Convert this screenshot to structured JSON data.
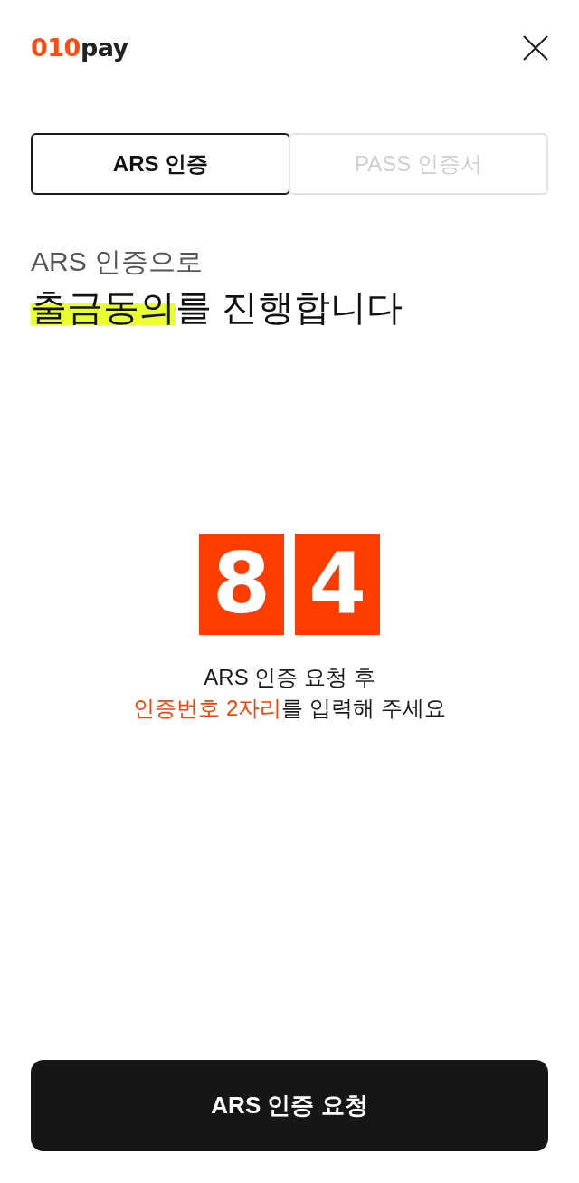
{
  "header": {
    "logo": {
      "accent": "010",
      "rest": "pay"
    }
  },
  "tabs": [
    {
      "label": "ARS 인증",
      "selected": true
    },
    {
      "label": "PASS 인증서",
      "selected": false
    }
  ],
  "heading": {
    "subtitle": "ARS 인증으로",
    "title": [
      {
        "text": "출금동의",
        "highlighted": true
      },
      {
        "text": "를 진행합니다",
        "highlighted": false
      }
    ]
  },
  "code": {
    "digits": [
      "8",
      "4"
    ]
  },
  "instruction": {
    "lines": [
      [
        {
          "text": "ARS 인증 요청 후",
          "accent": false
        }
      ],
      [
        {
          "text": "인증번호 2자리",
          "accent": true
        },
        {
          "text": "를 입력해 주세요",
          "accent": false
        }
      ]
    ]
  },
  "submit_button": {
    "label": "ARS 인증 요청"
  }
}
